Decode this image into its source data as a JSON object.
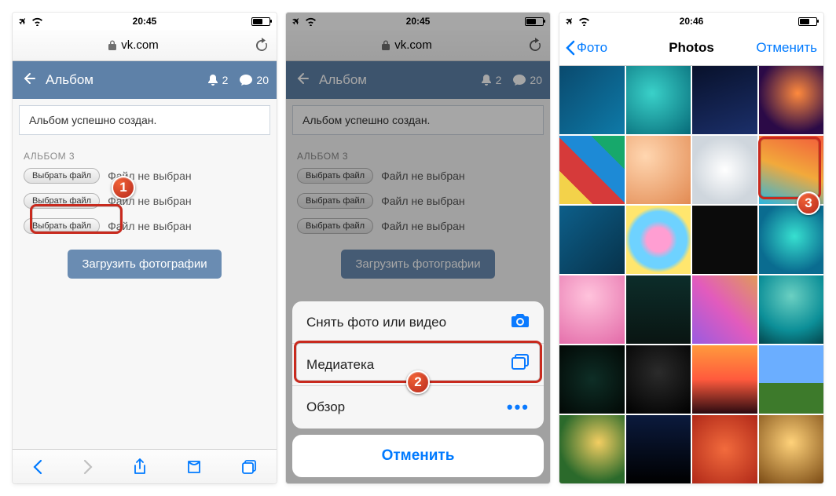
{
  "status": {
    "time1": "20:45",
    "time2": "20:45",
    "time3": "20:46"
  },
  "safari": {
    "domain": "vk.com"
  },
  "vk": {
    "header_title": "Альбом",
    "bell_count": "2",
    "chat_count": "20",
    "alert": "Альбом успешно создан.",
    "section_label": "АЛЬБОМ 3",
    "file_btn": "Выбрать файл",
    "file_status": "Файл не выбран",
    "upload": "Загрузить фотографии"
  },
  "sheet": {
    "take": "Снять фото или видео",
    "library": "Медиатека",
    "browse": "Обзор",
    "cancel": "Отменить"
  },
  "picker": {
    "back": "Фото",
    "title": "Photos",
    "cancel": "Отменить"
  },
  "badges": {
    "one": "1",
    "two": "2",
    "three": "3"
  }
}
